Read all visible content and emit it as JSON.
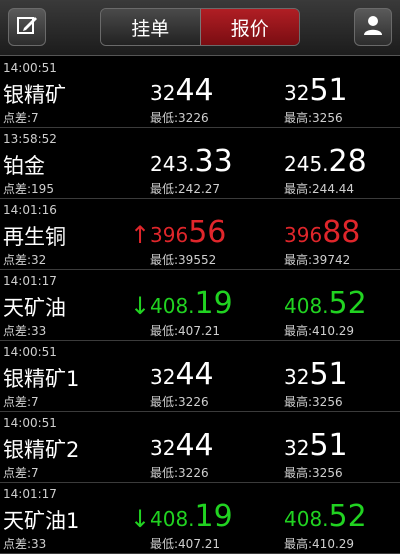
{
  "header": {
    "left_icon": "edit-icon",
    "right_icon": "user-icon",
    "tabs": [
      {
        "label": "挂单",
        "active": false
      },
      {
        "label": "报价",
        "active": true
      }
    ]
  },
  "colors": {
    "up": "#e0262b",
    "down": "#21d321",
    "neutral": "#ffffff",
    "active_tab": "#9a1419"
  },
  "quotes": [
    {
      "time": "14:00:51",
      "name": "银精矿",
      "spread": "点差:7",
      "trend": "none",
      "arrow": "",
      "bid_prefix": "32",
      "bid_suffix": "44",
      "ask_prefix": "32",
      "ask_suffix": "51",
      "low": "最低:3226",
      "high": "最高:3256"
    },
    {
      "time": "13:58:52",
      "name": "铂金",
      "spread": "点差:195",
      "trend": "none",
      "arrow": "",
      "bid_prefix": "243.",
      "bid_suffix": "33",
      "ask_prefix": "245.",
      "ask_suffix": "28",
      "low": "最低:242.27",
      "high": "最高:244.44"
    },
    {
      "time": "14:01:16",
      "name": "再生铜",
      "spread": "点差:32",
      "trend": "up",
      "arrow": "↑",
      "bid_prefix": "396",
      "bid_suffix": "56",
      "ask_prefix": "396",
      "ask_suffix": "88",
      "low": "最低:39552",
      "high": "最高:39742"
    },
    {
      "time": "14:01:17",
      "name": "天矿油",
      "spread": "点差:33",
      "trend": "down",
      "arrow": "↓",
      "bid_prefix": "408.",
      "bid_suffix": "19",
      "ask_prefix": "408.",
      "ask_suffix": "52",
      "low": "最低:407.21",
      "high": "最高:410.29"
    },
    {
      "time": "14:00:51",
      "name": "银精矿1",
      "spread": "点差:7",
      "trend": "none",
      "arrow": "",
      "bid_prefix": "32",
      "bid_suffix": "44",
      "ask_prefix": "32",
      "ask_suffix": "51",
      "low": "最低:3226",
      "high": "最高:3256"
    },
    {
      "time": "14:00:51",
      "name": "银精矿2",
      "spread": "点差:7",
      "trend": "none",
      "arrow": "",
      "bid_prefix": "32",
      "bid_suffix": "44",
      "ask_prefix": "32",
      "ask_suffix": "51",
      "low": "最低:3226",
      "high": "最高:3256"
    },
    {
      "time": "14:01:17",
      "name": "天矿油1",
      "spread": "点差:33",
      "trend": "down",
      "arrow": "↓",
      "bid_prefix": "408.",
      "bid_suffix": "19",
      "ask_prefix": "408.",
      "ask_suffix": "52",
      "low": "最低:407.21",
      "high": "最高:410.29"
    }
  ]
}
